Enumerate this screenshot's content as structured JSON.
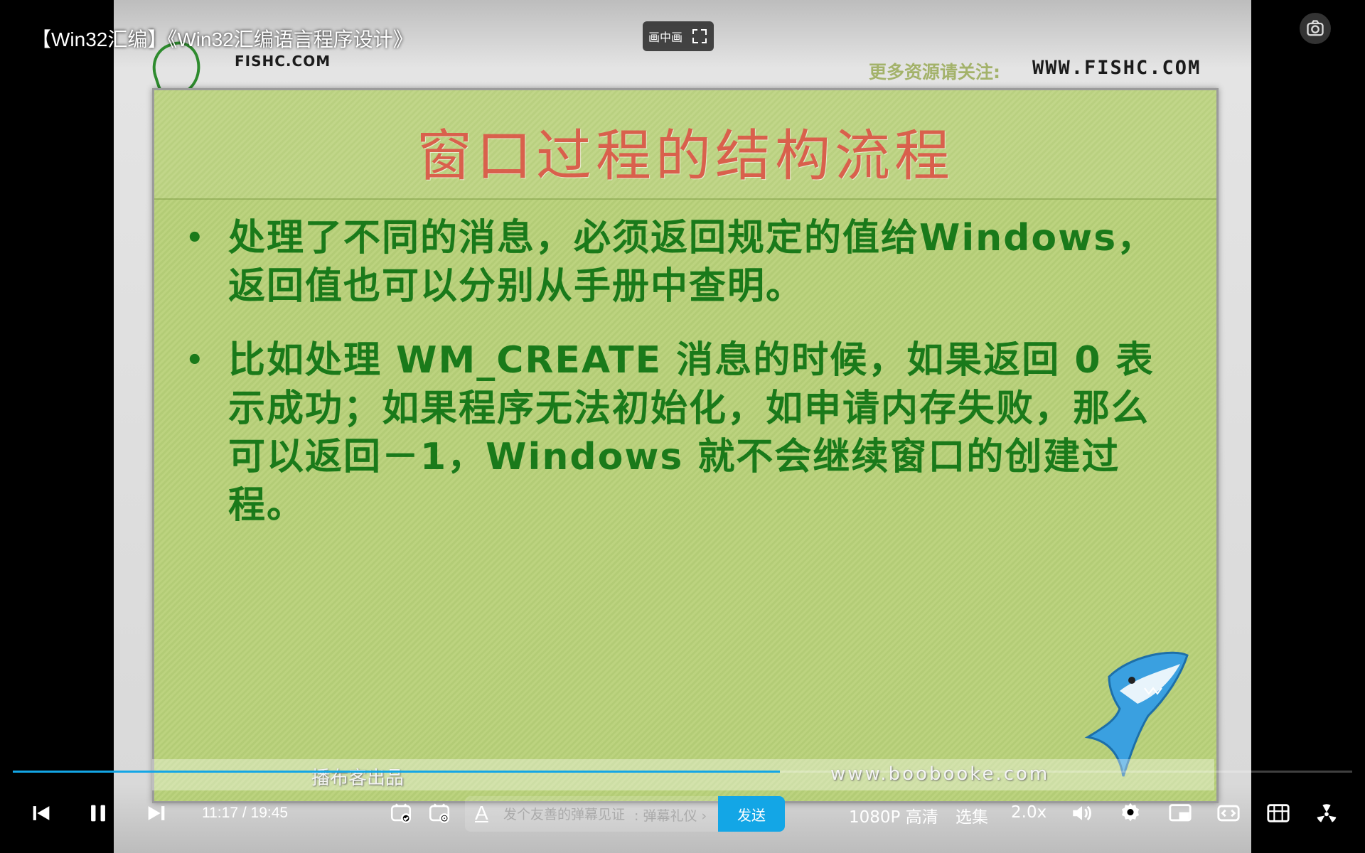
{
  "video": {
    "title": "【Win32汇编】《Win32汇编语言程序设计》",
    "pip_label": "画中画",
    "progress_fraction": 0.5729
  },
  "slide": {
    "logo_text": "FISHC.COM",
    "promo_label": "更多资源请关注:",
    "promo_url": "WWW.FISHC.COM",
    "title": "窗口过程的结构流程",
    "bullets": [
      "处理了不同的消息，必须返回规定的值给Windows，返回值也可以分别从手册中查明。",
      "比如处理 WM_CREATE 消息的时候，如果返回 0 表示成功；如果程序无法初始化，如申请内存失败，那么可以返回－1，Windows 就不会继续窗口的创建过程。"
    ],
    "bullet_symbol": "•",
    "studio_credit": "播布客出品",
    "studio_url": "www.boobooke.com"
  },
  "controls": {
    "time_current": "11:17",
    "time_separator": "/",
    "time_total": "19:45",
    "danmaku_placeholder": "发个友善的弹幕见证",
    "danmaku_etiquette": ": 弹幕礼仪 ›",
    "danmaku_style_glyph": "A",
    "send_label": "发送",
    "quality_label": "1080P 高清",
    "episodes_label": "选集",
    "speed_label": "2.0x"
  },
  "colors": {
    "accent": "#13a6e6",
    "slide_title": "#d9604c",
    "slide_text": "#1a7a1a",
    "board_green": "#b8d07b"
  }
}
